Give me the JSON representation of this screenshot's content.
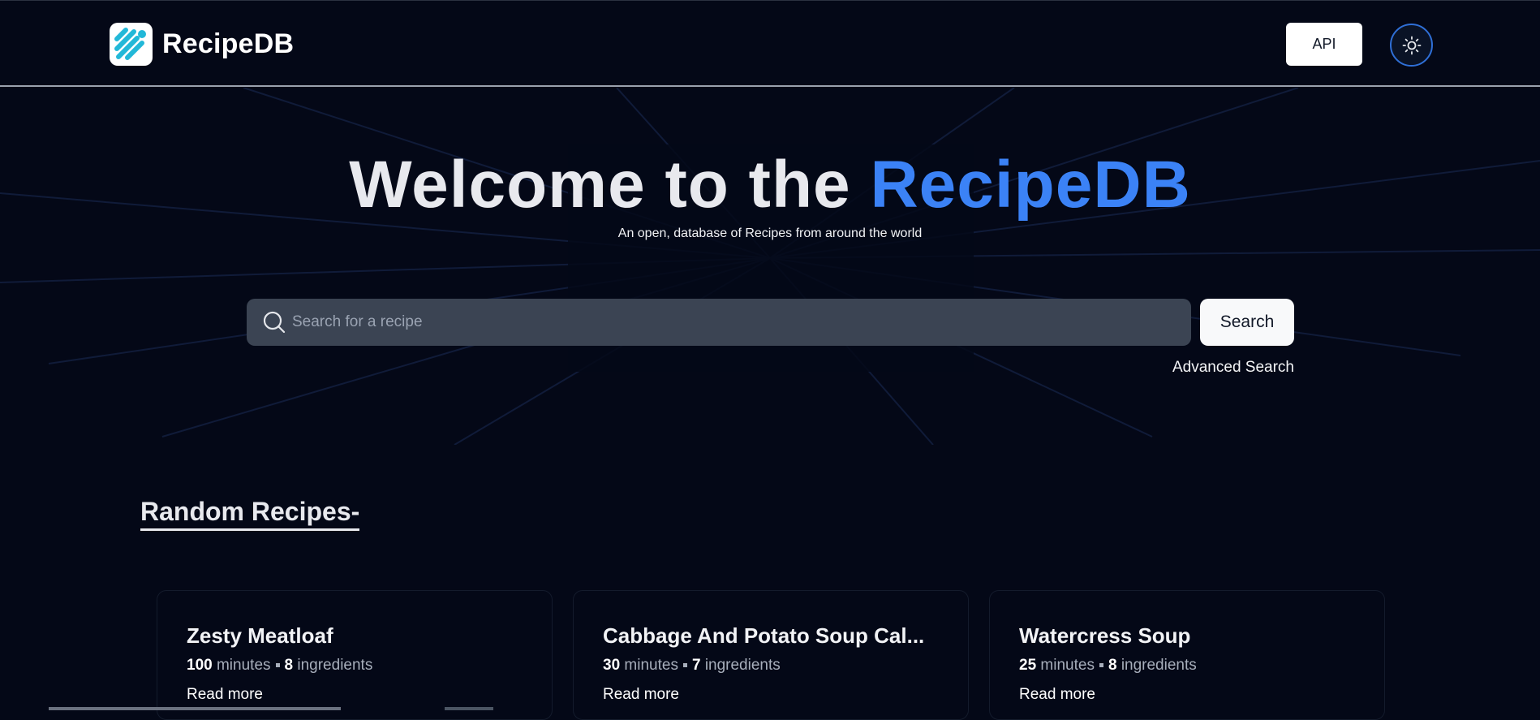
{
  "header": {
    "logo_text": "RecipeDB",
    "api_label": "API",
    "theme_icon": "sun-icon"
  },
  "hero": {
    "title_main": "Welcome to the ",
    "title_accent": "RecipeDB",
    "subtitle": "An open, database of Recipes from around the world"
  },
  "search": {
    "placeholder": "Search for a recipe",
    "value": "",
    "button_label": "Search",
    "advanced_label": "Advanced Search"
  },
  "random": {
    "title": "Random Recipes-",
    "cards": [
      {
        "title": "Zesty Meatloaf",
        "minutes": "100",
        "minutes_unit": "minutes",
        "ingredients": "8",
        "ingredients_unit": "ingredients",
        "link": "Read more"
      },
      {
        "title": "Cabbage And Potato Soup Cal...",
        "minutes": "30",
        "minutes_unit": "minutes",
        "ingredients": "7",
        "ingredients_unit": "ingredients",
        "link": "Read more"
      },
      {
        "title": "Watercress Soup",
        "minutes": "25",
        "minutes_unit": "minutes",
        "ingredients": "8",
        "ingredients_unit": "ingredients",
        "link": "Read more"
      }
    ]
  },
  "colors": {
    "background": "#040817",
    "accent": "#3b82f6",
    "search_bg": "#3b4453"
  }
}
